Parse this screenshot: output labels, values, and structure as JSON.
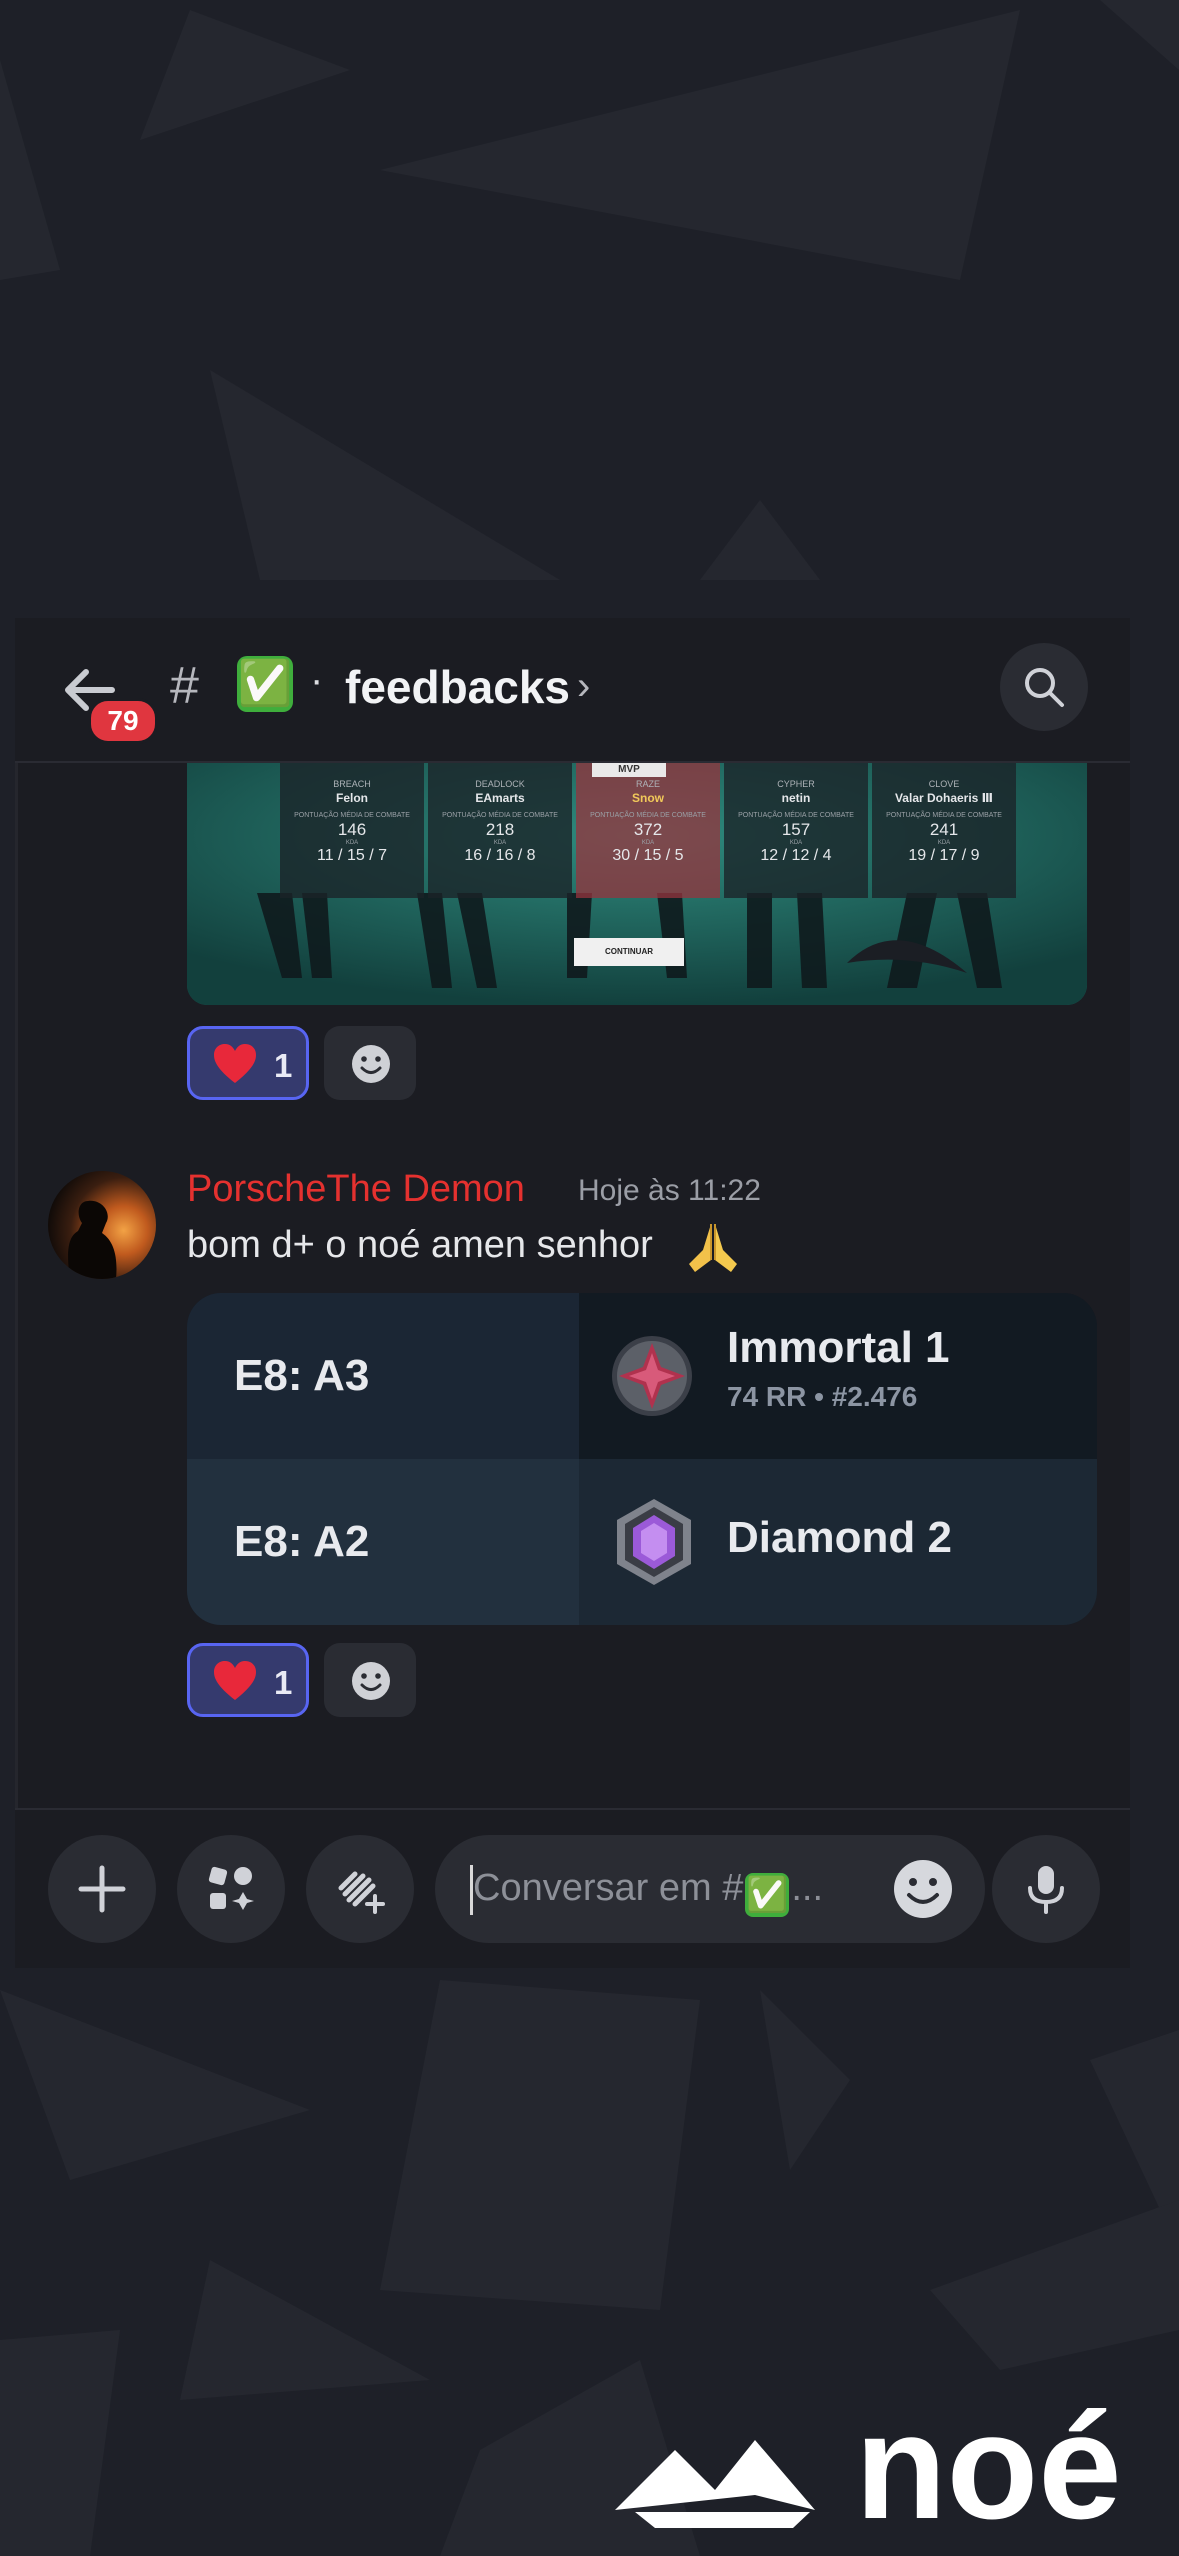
{
  "header": {
    "unread_badge": "79",
    "hash": "#",
    "channel_emoji": "✅",
    "separator": "·",
    "channel_name": "feedbacks",
    "chevron": "›"
  },
  "scoreboard": {
    "mvp_label": "MVP",
    "score_label": "PONTUAÇÃO MÉDIA DE COMBATE",
    "kda_label": "KDA",
    "continue_label": "CONTINUAR",
    "players": [
      {
        "agent": "BREACH",
        "name": "Felon",
        "score": "146",
        "kda": "11 / 15 / 7"
      },
      {
        "agent": "DEADLOCK",
        "name": "EAmarts",
        "score": "218",
        "kda": "16 / 16 / 8"
      },
      {
        "agent": "RAZE",
        "name": "Snow",
        "score": "372",
        "kda": "30 / 15 / 5"
      },
      {
        "agent": "CYPHER",
        "name": "netin",
        "score": "157",
        "kda": "12 / 12 / 4"
      },
      {
        "agent": "CLOVE",
        "name": "Valar Dohaeris Ⅲ",
        "score": "241",
        "kda": "19 / 17 / 9"
      }
    ]
  },
  "reactions_1": {
    "heart_count": "1"
  },
  "message": {
    "username": "PorscheThe Demon",
    "timestamp": "Hoje às 11:22",
    "text": "bom d+ o noé amen senhor"
  },
  "rank_embed": {
    "rows": [
      {
        "season": "E8: A3",
        "rank": "Immortal 1",
        "details": "74 RR • #2.476"
      },
      {
        "season": "E8: A2",
        "rank": "Diamond 2",
        "details": ""
      }
    ]
  },
  "reactions_2": {
    "heart_count": "1"
  },
  "composer": {
    "placeholder_prefix": "Conversar em #",
    "placeholder_emoji": "✅",
    "placeholder_suffix": "..."
  },
  "watermark": {
    "text": "noé"
  },
  "colors": {
    "accent": "#5865f2",
    "username": "#e5312f",
    "badge": "#e0363f",
    "background": "#1e2028"
  }
}
